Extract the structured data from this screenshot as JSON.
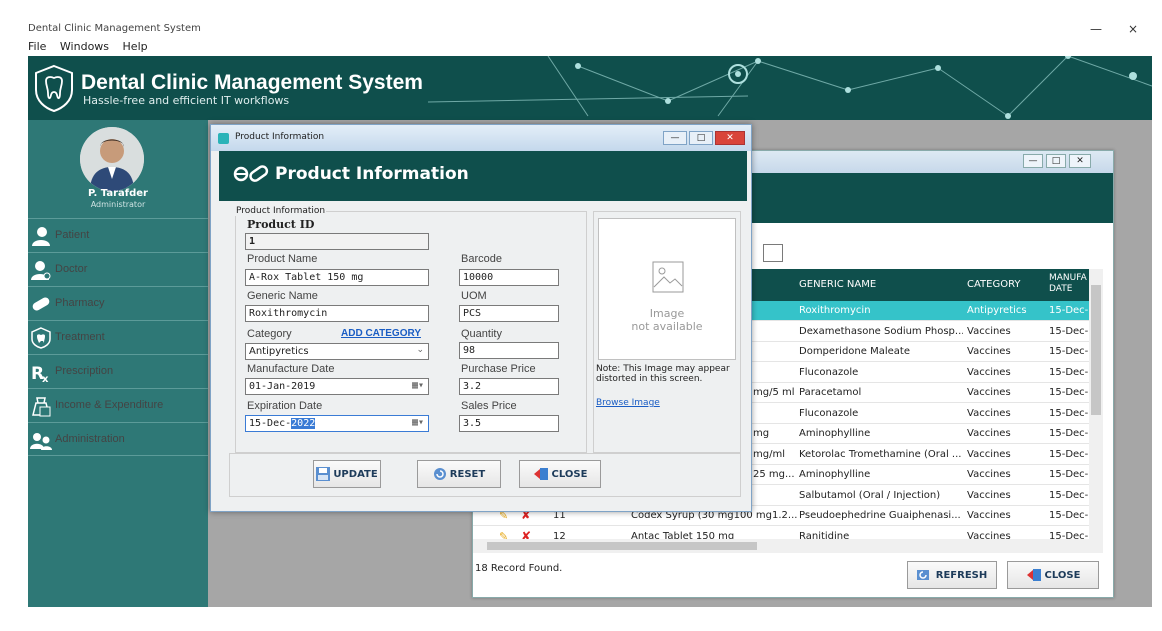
{
  "window": {
    "title": "Dental Clinic Management System",
    "controls": [
      "—",
      "×"
    ]
  },
  "menu": [
    "File",
    "Windows",
    "Help"
  ],
  "header": {
    "title": "Dental Clinic Management System",
    "subtitle": "Hassle-free and efficient IT workflows"
  },
  "profile": {
    "name": "P. Tarafder",
    "role": "Administrator"
  },
  "sidebar": [
    {
      "label": "Patient",
      "icon": "patient-icon"
    },
    {
      "label": "Doctor",
      "icon": "doctor-icon"
    },
    {
      "label": "Pharmacy",
      "icon": "pill-icon"
    },
    {
      "label": "Treatment",
      "icon": "tooth-icon"
    },
    {
      "label": "Prescription",
      "icon": "rx-icon"
    },
    {
      "label": "Income & Expenditure",
      "icon": "money-icon"
    },
    {
      "label": "Administration",
      "icon": "users-icon"
    }
  ],
  "list_window": {
    "controls": [
      "—",
      "□",
      "✕"
    ],
    "columns": [
      "GENERIC NAME",
      "CATEGORY",
      "MANUFA DATE"
    ],
    "rows": [
      {
        "product": "",
        "generic": "Roxithromycin",
        "category": "Antipyretics",
        "date": "15-Dec-",
        "selected": true
      },
      {
        "product": "",
        "generic": "Dexamethasone Sodium Phosp...",
        "category": "Vaccines",
        "date": "15-Dec-"
      },
      {
        "product": "",
        "generic": "Domperidone Maleate",
        "category": "Vaccines",
        "date": "15-Dec-"
      },
      {
        "product": "",
        "generic": "Fluconazole",
        "category": "Vaccines",
        "date": "15-Dec-"
      },
      {
        "product": "mg/5 ml",
        "generic": "Paracetamol",
        "category": "Vaccines",
        "date": "15-Dec-"
      },
      {
        "product": "",
        "generic": "Fluconazole",
        "category": "Vaccines",
        "date": "15-Dec-"
      },
      {
        "product": "mg",
        "generic": "Aminophylline",
        "category": "Vaccines",
        "date": "15-Dec-"
      },
      {
        "product": "mg/ml",
        "generic": "Ketorolac Tromethamine (Oral ...",
        "category": "Vaccines",
        "date": "15-Dec-"
      },
      {
        "product": "25 mg...",
        "generic": "Aminophylline",
        "category": "Vaccines",
        "date": "15-Dec-"
      },
      {
        "product": "",
        "generic": "Salbutamol (Oral / Injection)",
        "category": "Vaccines",
        "date": "15-Dec-"
      },
      {
        "id": "11",
        "product": "Codex Syrup (30 mg100 mg1.2...",
        "generic": "Pseudoephedrine  Guaiphenasi...",
        "category": "Vaccines",
        "date": "15-Dec-"
      },
      {
        "id": "12",
        "product": "Antac Tablet 150 mg",
        "generic": "Ranitidine",
        "category": "Vaccines",
        "date": "15-Dec-"
      }
    ],
    "record_count": "18 Record Found.",
    "refresh_label": "REFRESH",
    "close_label": "CLOSE"
  },
  "dialog": {
    "title": "Product Information",
    "header": "Product Information",
    "controls": [
      "—",
      "□",
      "✕"
    ],
    "fieldset_label": "Product Information",
    "product_id_label": "Product ID",
    "product_id": "1",
    "product_name_label": "Product Name",
    "product_name": "A-Rox Tablet 150 mg",
    "barcode_label": "Barcode",
    "barcode": "10000",
    "generic_name_label": "Generic Name",
    "generic_name": "Roxithromycin",
    "uom_label": "UOM",
    "uom": "PCS",
    "category_label": "Category",
    "add_category": "ADD CATEGORY",
    "category": "Antipyretics",
    "quantity_label": "Quantity",
    "quantity": "98",
    "manufacture_date_label": "Manufacture Date",
    "manufacture_date": "01-Jan-2019",
    "purchase_price_label": "Purchase Price",
    "purchase_price": "3.2",
    "expiration_date_label": "Expiration Date",
    "expiration_date_prefix": "15-Dec-",
    "expiration_date_selected": "2022",
    "sales_price_label": "Sales Price",
    "sales_price": "3.5",
    "image_placeholder_line1": "Image",
    "image_placeholder_line2": "not available",
    "image_note": "Note: This Image may appear distorted in this screen.",
    "browse_image": "Browse Image",
    "update_label": "UPDATE",
    "reset_label": "RESET",
    "close_label": "CLOSE"
  },
  "colors": {
    "primary": "#0f4f4c",
    "sidebar": "#2e7876",
    "selected_row": "#35c3c9",
    "link": "#1a5dc4"
  }
}
